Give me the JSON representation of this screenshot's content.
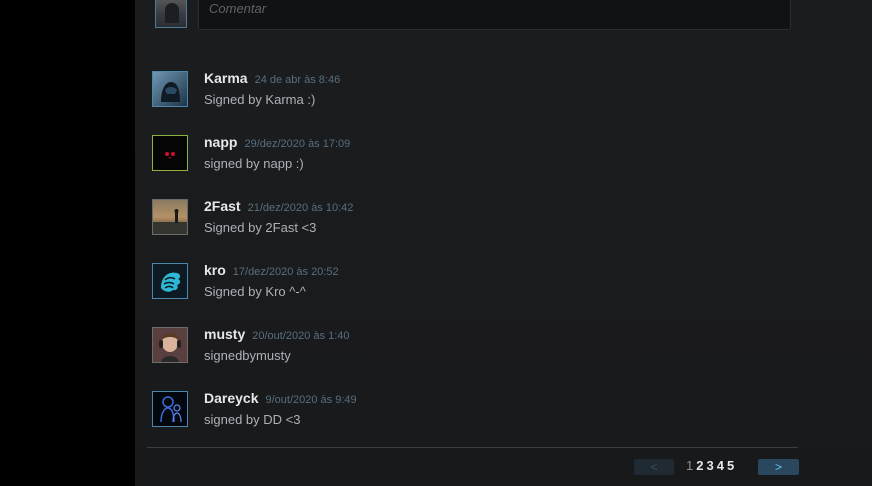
{
  "composer": {
    "placeholder": "Comentar"
  },
  "comments": [
    {
      "author": "Karma",
      "date": "24 de abr às 8:46",
      "text": "Signed by Karma :)",
      "avatar_icon": "hooded-figure-avatar"
    },
    {
      "author": "napp",
      "date": "29/dez/2020 às 17:09",
      "text": "signed by napp :)",
      "avatar_icon": "red-eyes-avatar"
    },
    {
      "author": "2Fast",
      "date": "21/dez/2020 às 10:42",
      "text": "Signed by 2Fast <3",
      "avatar_icon": "sunset-figure-avatar"
    },
    {
      "author": "kro",
      "date": "17/dez/2020 às 20:52",
      "text": "Signed by Kro ^-^",
      "avatar_icon": "cyan-lion-avatar"
    },
    {
      "author": "musty",
      "date": "20/out/2020 às 1:40",
      "text": "signedbymusty",
      "avatar_icon": "headset-person-avatar"
    },
    {
      "author": "Dareyck",
      "date": "9/out/2020 às 9:49",
      "text": "signed by DD <3",
      "avatar_icon": "blue-figures-avatar"
    }
  ],
  "pagination": {
    "prev_label": "<",
    "next_label": ">",
    "pages": [
      "1",
      "2",
      "3",
      "4",
      "5"
    ],
    "current": "1"
  },
  "colors": {
    "accent": "#67c1f5",
    "date": "#56707f",
    "text": "#acb2b8",
    "author": "#e6e7e8"
  }
}
